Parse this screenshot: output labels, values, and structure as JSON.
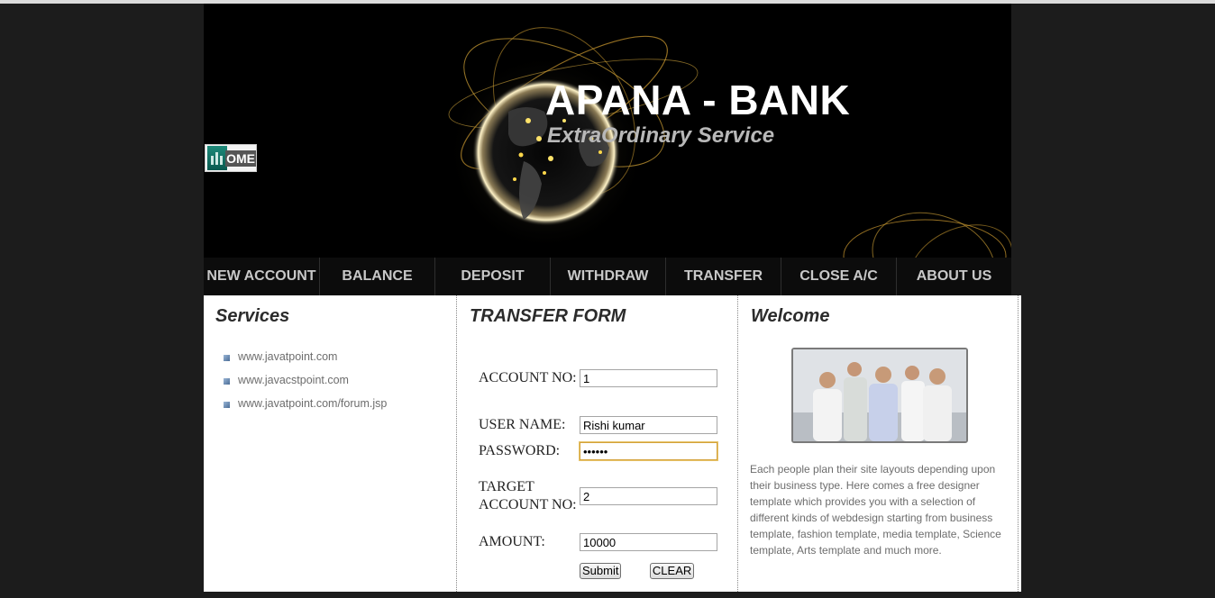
{
  "header": {
    "title": "APANA - BANK",
    "subtitle": "ExtraOrdinary Service",
    "home_label": "OME"
  },
  "nav": {
    "items": [
      "NEW ACCOUNT",
      "BALANCE",
      "DEPOSIT",
      "WITHDRAW",
      "TRANSFER",
      "CLOSE A/C",
      "ABOUT US"
    ]
  },
  "services": {
    "heading": "Services",
    "links": [
      "www.javatpoint.com",
      "www.javacstpoint.com",
      "www.javatpoint.com/forum.jsp"
    ]
  },
  "transfer_form": {
    "heading": "TRANSFER FORM",
    "account_no_label": "ACCOUNT NO:",
    "account_no_value": "1",
    "username_label": "USER NAME:",
    "username_value": "Rishi kumar",
    "password_label": "PASSWORD:",
    "password_value": "hidden",
    "target_account_label": "TARGET ACCOUNT NO:",
    "target_account_value": "2",
    "amount_label": "AMOUNT:",
    "amount_value": "10000",
    "submit_label": "Submit",
    "clear_label": "CLEAR"
  },
  "welcome": {
    "heading": "Welcome",
    "text": "Each people plan their site layouts depending upon their business type. Here comes a free designer template which provides you with a selection of different kinds of webdesign starting from business template, fashion template, media template, Science template, Arts template and much more."
  },
  "colors": {
    "page_bg": "#1c1c1c",
    "header_bg": "#000000",
    "nav_text": "#c8c8c8",
    "focus_border": "#d4a23a"
  }
}
